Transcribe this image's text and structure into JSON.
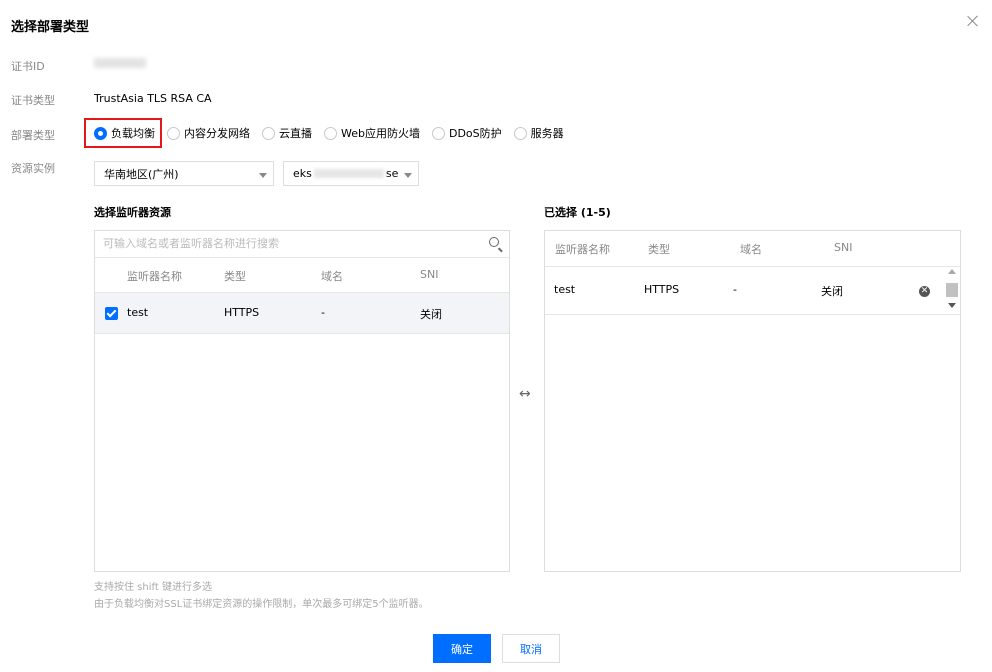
{
  "dialog": {
    "title": "选择部署类型"
  },
  "form": {
    "cert_id_label": "证书ID",
    "cert_type_label": "证书类型",
    "cert_type_value": "TrustAsia TLS RSA CA",
    "deploy_type_label": "部署类型",
    "resource_label": "资源实例",
    "deploy_types": [
      "负载均衡",
      "内容分发网络",
      "云直播",
      "Web应用防火墙",
      "DDoS防护",
      "服务器"
    ],
    "selected_deploy_type": "负载均衡",
    "region_select": "华南地区(广州)",
    "instance_prefix": "eks",
    "instance_suffix": "se"
  },
  "left_panel": {
    "title": "选择监听器资源",
    "search_placeholder": "可输入域名或者监听器名称进行搜索",
    "columns": [
      "监听器名称",
      "类型",
      "域名",
      "SNI"
    ],
    "rows": [
      {
        "name": "test",
        "type": "HTTPS",
        "domain": "-",
        "sni": "关闭",
        "checked": true
      }
    ]
  },
  "right_panel": {
    "title": "已选择 (1-5)",
    "columns": [
      "监听器名称",
      "类型",
      "域名",
      "SNI"
    ],
    "rows": [
      {
        "name": "test",
        "type": "HTTPS",
        "domain": "-",
        "sni": "关闭"
      }
    ]
  },
  "transfer_icon": "↔",
  "hints": {
    "line1": "支持按住 shift 键进行多选",
    "line2": "由于负载均衡对SSL证书绑定资源的操作限制，单次最多可绑定5个监听器。"
  },
  "buttons": {
    "confirm": "确定",
    "cancel": "取消"
  },
  "colors": {
    "primary": "#006eff",
    "highlight_border": "#e3181a",
    "selected_row_bg": "#f2f4f8"
  }
}
